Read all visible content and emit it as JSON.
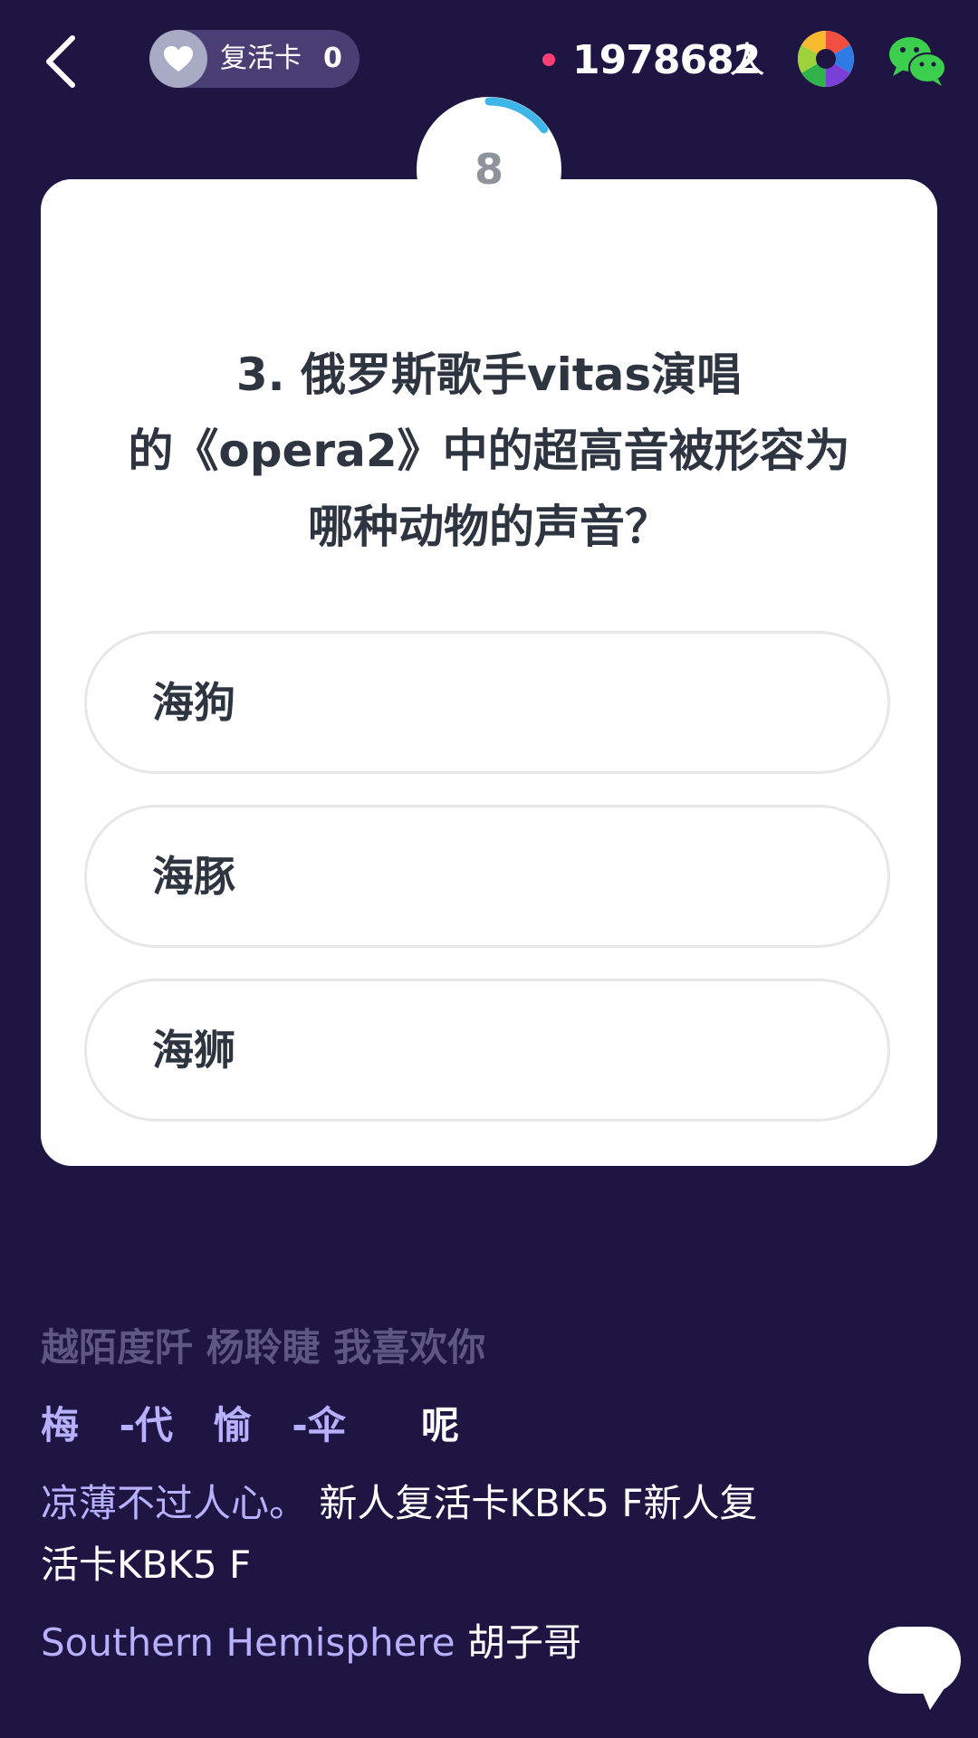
{
  "header": {
    "revive_card_label": "复活卡",
    "revive_card_count": "0",
    "online_count": "1978682",
    "online_unit": "人"
  },
  "timer": {
    "seconds": "8",
    "progress": 0.15
  },
  "question": {
    "line1": "3. 俄罗斯歌手vitas演唱",
    "line2": "的《opera2》中的超高音被形容为",
    "line3": "哪种动物的声音？"
  },
  "options": [
    {
      "label": "海狗"
    },
    {
      "label": "海豚"
    },
    {
      "label": "海狮"
    }
  ],
  "chat": [
    {
      "name": "越陌度阡 杨聆睫 我喜欢你",
      "text": ""
    },
    {
      "name": "梅 -代 愉 -伞",
      "text": "呢"
    },
    {
      "name": "凉薄不过人心。",
      "text": "新人复活卡KBK5 F新人复",
      "text_cont": "活卡KBK5 F"
    },
    {
      "name": "Southern Hemisphere",
      "text": "胡子哥"
    }
  ],
  "colors": {
    "background": "#1e1542",
    "card": "#ffffff",
    "timer_arc": "#3fb6e8",
    "live_dot": "#ff3d77",
    "chat_name": "#b6b0ff"
  }
}
